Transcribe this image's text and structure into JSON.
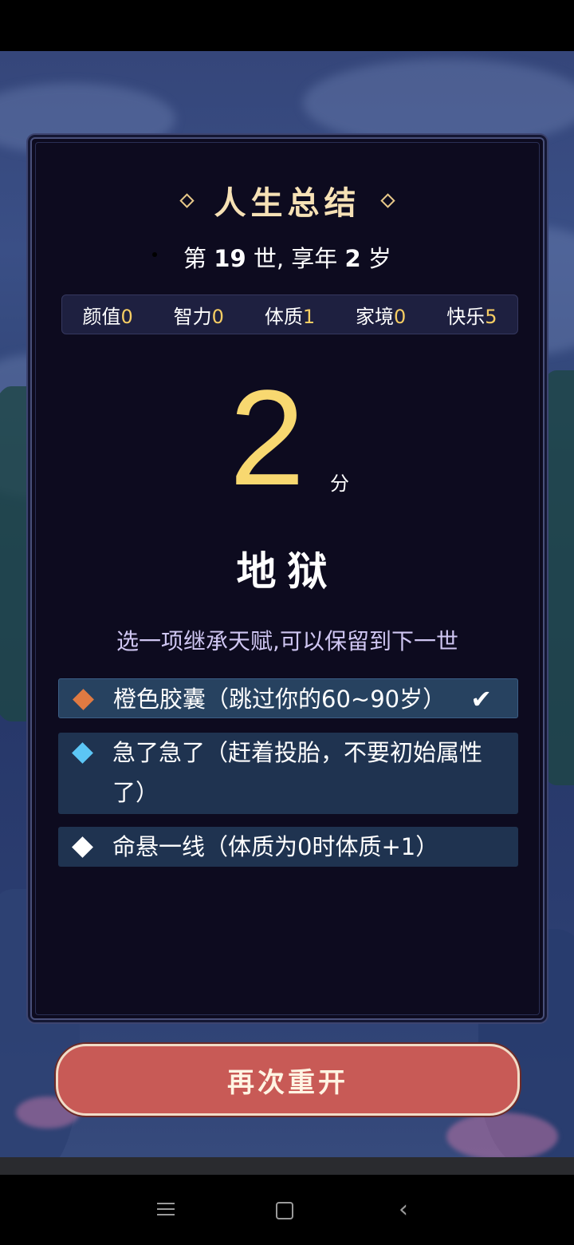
{
  "summary": {
    "title": "人生总结",
    "life_line": {
      "prefix": "第",
      "life_num": "19",
      "mid": "世, 享年",
      "age": "2",
      "suffix": "岁"
    }
  },
  "stats": [
    {
      "label": "颜值",
      "value": "0"
    },
    {
      "label": "智力",
      "value": "0"
    },
    {
      "label": "体质",
      "value": "1"
    },
    {
      "label": "家境",
      "value": "0"
    },
    {
      "label": "快乐",
      "value": "5"
    }
  ],
  "score": {
    "value": "2",
    "unit": "分"
  },
  "grade": "地狱",
  "inherit_prompt": "选一项继承天赋,可以保留到下一世",
  "talents": [
    {
      "text": "橙色胶囊（跳过你的60~90岁）",
      "color": "#e07a42",
      "selected": true
    },
    {
      "text": "急了急了（赶着投胎，不要初始属性了）",
      "color": "#5cc6f5",
      "selected": false
    },
    {
      "text": "命悬一线（体质为0时体质+1）",
      "color": "#ffffff",
      "selected": false
    }
  ],
  "check_mark": "✔",
  "restart_label": "再次重开",
  "icons": {
    "menu": "menu-icon",
    "home": "home-square-icon",
    "back": "back-chevron-icon"
  },
  "nav": {
    "back_glyph": "‹"
  }
}
